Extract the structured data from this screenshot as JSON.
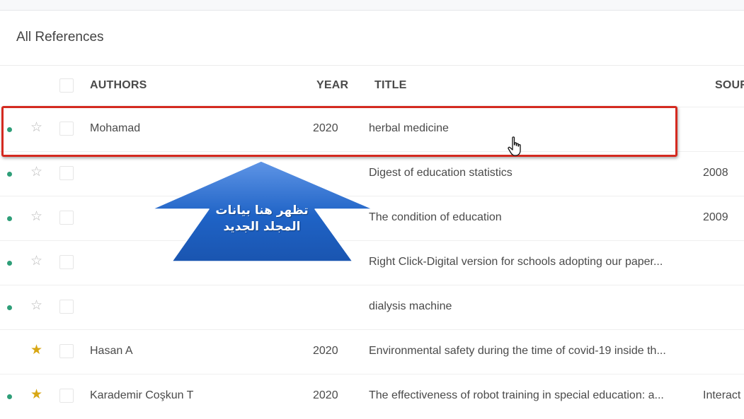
{
  "header": {
    "title": "All References"
  },
  "columns": {
    "authors": "AUTHORS",
    "year": "YEAR",
    "title": "TITLE",
    "source": "SOUR"
  },
  "rows": [
    {
      "unread": true,
      "starred": false,
      "author": "Mohamad",
      "year": "2020",
      "title": "herbal medicine",
      "source": ""
    },
    {
      "unread": true,
      "starred": false,
      "author": "",
      "year": "",
      "title": "Digest of education statistics",
      "source": "2008"
    },
    {
      "unread": true,
      "starred": false,
      "author": "",
      "year": "",
      "title": "The condition of education",
      "source": "2009"
    },
    {
      "unread": true,
      "starred": false,
      "author": "",
      "year": "",
      "title": "Right Click-Digital version for schools adopting our paper...",
      "source": ""
    },
    {
      "unread": true,
      "starred": false,
      "author": "",
      "year": "",
      "title": "dialysis machine",
      "source": ""
    },
    {
      "unread": false,
      "starred": true,
      "author": "Hasan A",
      "year": "2020",
      "title": "Environmental safety during the time of covid-19 inside th...",
      "source": ""
    },
    {
      "unread": true,
      "starred": true,
      "author": "Karademir Coşkun T",
      "year": "2020",
      "title": "The effectiveness of robot training in special education: a...",
      "source": "Interact"
    }
  ],
  "annotation": {
    "callout_line1": "تظهر هنا بيانات",
    "callout_line2": "المجلد الجديد",
    "highlight_color": "#d42a20",
    "arrow_color": "#1f63c6"
  },
  "colors": {
    "unread_dot": "#2e9e78",
    "star_on": "#d8a714",
    "star_off": "#b9b9b9"
  },
  "icons": {
    "star_off": "☆",
    "star_on": "★"
  }
}
